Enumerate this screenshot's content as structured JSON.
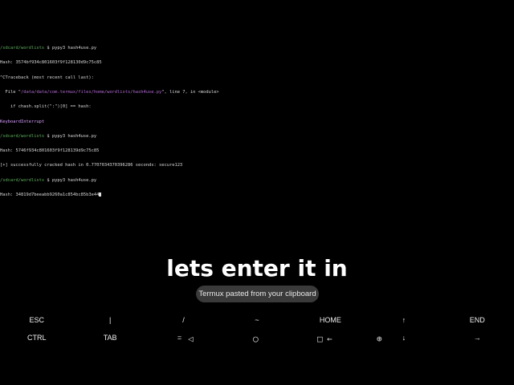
{
  "terminal": {
    "lines": [
      {
        "path": "/sdcard/wordlists",
        "cmd": " $ pypy3 hash4use.py"
      },
      {
        "text": "Hash: 3574bf934c801603f9f128130d9c75c85"
      },
      {
        "text": "^CTraceback (most recent call last):"
      },
      {
        "pre": "  File \"",
        "path": "/data/data/com.termux/files/home/wordlists/hash4use.py",
        "post": "\", line 7, in <module>"
      },
      {
        "text": "    if chash.split(\":\")[0] == hash:"
      },
      {
        "kb": "KeyboardInterrupt"
      },
      {
        "path": "/sdcard/wordlists",
        "cmd": " $ pypy3 hash4use.py"
      },
      {
        "text": "Hash: 5746f934c801603f9f128139d9c75c85"
      },
      {
        "text": "[+] successfully cracked hash in 0.7707034370396286 seconds: secure123"
      },
      {
        "path": "/sdcard/wordlists",
        "cmd": " $ pypy3 hash4use.py"
      },
      {
        "text": "Hash: 34819d7beeabb9260a1c854bc85b3e44"
      }
    ]
  },
  "caption": "lets enter it in",
  "toast": "Termux pasted from your clipboard",
  "extra_keys": {
    "row1": [
      "ESC",
      "|",
      "/",
      "~",
      "HOME",
      "↑",
      "END"
    ],
    "row2": [
      "CTRL",
      "TAB",
      "=",
      "",
      "",
      "↓",
      "→"
    ]
  },
  "nav_icons": [
    "back-icon",
    "home-icon",
    "recents-icon",
    "keyboard-icon"
  ],
  "nav_symbols": {
    "back": "◁",
    "home": "◯",
    "recents": "□",
    "backspace": "←",
    "globe": "⊕"
  }
}
